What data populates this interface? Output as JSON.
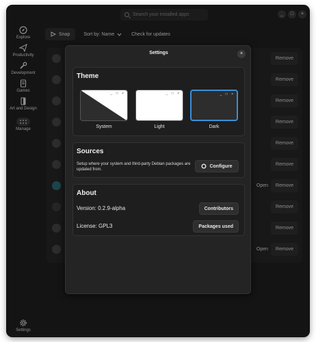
{
  "search": {
    "placeholder": "Search your installed apps"
  },
  "window_controls": {
    "minimize": "_",
    "maximize": "□",
    "close": "×"
  },
  "sidebar": {
    "items": [
      {
        "label": "Explore",
        "icon": "compass-icon"
      },
      {
        "label": "Productivity",
        "icon": "send-icon"
      },
      {
        "label": "Development",
        "icon": "wrench-icon"
      },
      {
        "label": "Games",
        "icon": "gamepad-icon"
      },
      {
        "label": "Art and Design",
        "icon": "brush-icon"
      },
      {
        "label": "Manage",
        "icon": "dots-icon"
      }
    ],
    "settings_label": "Settings"
  },
  "toolbar": {
    "snap_label": "Snap",
    "sort_label": "Sort by: Name",
    "check_updates_label": "Check for updates"
  },
  "list": {
    "remove_label": "Remove",
    "open_label": "Open"
  },
  "dialog": {
    "title": "Settings",
    "close": "×",
    "theme": {
      "title": "Theme",
      "options": [
        "System",
        "Light",
        "Dark"
      ],
      "selected": "Dark"
    },
    "sources": {
      "title": "Sources",
      "description": "Setup where your system and third-party Debian packages are updated from.",
      "configure_label": "Configure"
    },
    "about": {
      "title": "About",
      "version": "Version: 0.2.9-alpha",
      "license": "License: GPL3",
      "contributors_label": "Contributors",
      "packages_label": "Packages used"
    }
  },
  "colors": {
    "accent": "#3b8fd9",
    "background": "#1f1f1f",
    "card": "#1e1e1e"
  }
}
